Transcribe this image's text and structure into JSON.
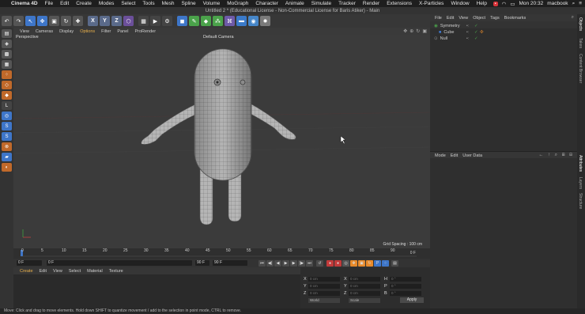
{
  "macmenu": {
    "apple": "",
    "app": "Cinema 4D",
    "items": [
      "File",
      "Edit",
      "Create",
      "Modes",
      "Select",
      "Tools",
      "Mesh",
      "Spline",
      "Volume",
      "MoGraph",
      "Character",
      "Animate",
      "Simulate",
      "Tracker",
      "Render",
      "Extensions",
      "X-Particles",
      "Window",
      "Help"
    ],
    "clock": "Mon 20:32",
    "user": "macbook"
  },
  "window": {
    "title": "Untitled 2 * (Educational License - Non-Commercial License for Baris Atiker) - Main"
  },
  "toolbar": {
    "axis_x": "X",
    "axis_y": "Y",
    "axis_z": "Z",
    "icons": [
      "undo-icon",
      "live-select-icon",
      "move-icon",
      "scale-icon",
      "rotate-icon",
      "add-object-icon"
    ]
  },
  "viewport": {
    "menu": [
      "View",
      "Cameras",
      "Display",
      "Options",
      "Filter",
      "Panel",
      "ProRender"
    ],
    "active_menu": "Options",
    "label": "Perspective",
    "camera": "Default Camera",
    "grid_spacing": "Grid Spacing : 100 cm"
  },
  "timeline": {
    "ticks": [
      "0",
      "5",
      "10",
      "15",
      "20",
      "25",
      "30",
      "35",
      "40",
      "45",
      "50",
      "55",
      "60",
      "65",
      "70",
      "75",
      "80",
      "85",
      "90"
    ],
    "end_label": "0 F",
    "current_frame": "0 F",
    "min_frame": "0 F",
    "max_frame": "90 F",
    "max_frame2": "90 F"
  },
  "materials": {
    "menu": [
      "Create",
      "Edit",
      "View",
      "Select",
      "Material",
      "Texture"
    ]
  },
  "coordinates": {
    "x_label": "X",
    "y_label": "Y",
    "z_label": "Z",
    "pos_x": "0 cm",
    "pos_y": "0 cm",
    "pos_z": "0 cm",
    "size_x": "0 cm",
    "size_y": "0 cm",
    "size_z": "0 cm",
    "h_label": "H",
    "p_label": "P",
    "b_label": "B",
    "rot_h": "0 °",
    "rot_p": "0 °",
    "rot_b": "0 °",
    "mode": "World",
    "size_mode": "Scale",
    "apply": "Apply"
  },
  "object_manager": {
    "menu": [
      "File",
      "Edit",
      "View",
      "Object",
      "Tags",
      "Bookmarks"
    ],
    "objects": [
      {
        "name": "Symmetry",
        "indent": 0
      },
      {
        "name": "Cube",
        "indent": 1
      },
      {
        "name": "Null",
        "indent": 0
      }
    ]
  },
  "attributes": {
    "menu": [
      "Mode",
      "Edit",
      "User Data"
    ]
  },
  "right_tabs": [
    "Objects",
    "Takes",
    "Content Browser",
    "Attributes",
    "Layers",
    "Structure"
  ],
  "status": "Move: Click and drag to move elements. Hold down SHIFT to quantize movement / add to the selection in point mode, CTRL to remove.",
  "colors": {
    "accent": "#e88a2a",
    "selected": "#3e76c9",
    "viewport_bg": "#3b3b3b"
  }
}
